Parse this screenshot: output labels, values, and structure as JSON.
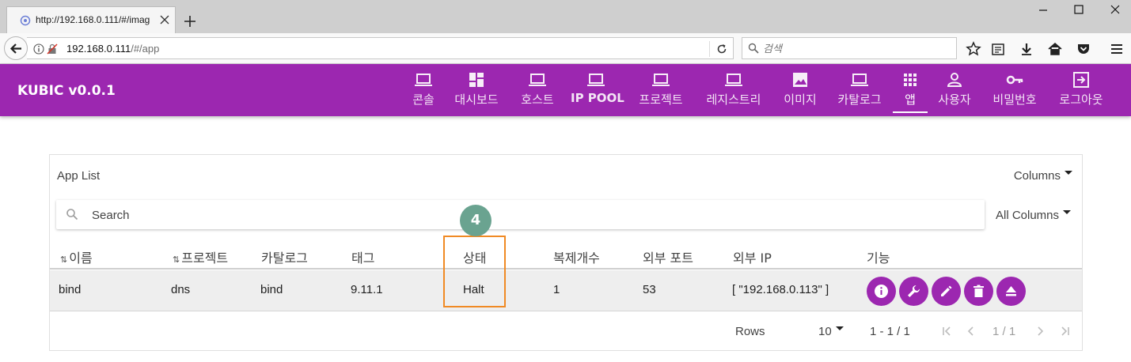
{
  "browser": {
    "tab_title": "http://192.168.0.111/#/imag",
    "url_host": "192.168.0.111",
    "url_path": "/#/app",
    "search_placeholder": "검색"
  },
  "app": {
    "brand": "KUBIC v0.0.1",
    "accent_color": "#9c27b0",
    "nav": [
      {
        "label": "콘솔",
        "icon": "laptop-icon"
      },
      {
        "label": "대시보드",
        "icon": "dashboard-icon"
      },
      {
        "label": "호스트",
        "icon": "laptop-icon"
      },
      {
        "label": "IP POOL",
        "icon": "laptop-icon"
      },
      {
        "label": "프로젝트",
        "icon": "laptop-icon"
      },
      {
        "label": "레지스트리",
        "icon": "laptop-icon"
      },
      {
        "label": "이미지",
        "icon": "image-icon"
      },
      {
        "label": "카탈로그",
        "icon": "laptop-icon"
      },
      {
        "label": "앱",
        "icon": "apps-grid-icon",
        "active": true
      },
      {
        "label": "사용자",
        "icon": "person-icon"
      },
      {
        "label": "비밀번호",
        "icon": "key-icon"
      },
      {
        "label": "로그아웃",
        "icon": "logout-icon"
      }
    ]
  },
  "card": {
    "title": "App List",
    "columns_label": "Columns",
    "search_placeholder": "Search",
    "all_columns_label": "All Columns",
    "step_badge": "4",
    "headers": [
      "이름",
      "프로젝트",
      "카탈로그",
      "태그",
      "상태",
      "복제개수",
      "외부 포트",
      "외부 IP",
      "기능"
    ],
    "rows": [
      {
        "name": "bind",
        "project": "dns",
        "catalog": "bind",
        "tag": "9.11.1",
        "status": "Halt",
        "replicas": "1",
        "external_port": "53",
        "external_ip": "[ \"192.168.0.113\" ]",
        "actions": [
          "info-icon",
          "wrench-icon",
          "edit-icon",
          "delete-icon",
          "eject-icon"
        ]
      }
    ],
    "footer": {
      "rows_label": "Rows",
      "rows_per_page": "10",
      "range": "1 - 1 / 1",
      "page": "1 / 1"
    }
  }
}
